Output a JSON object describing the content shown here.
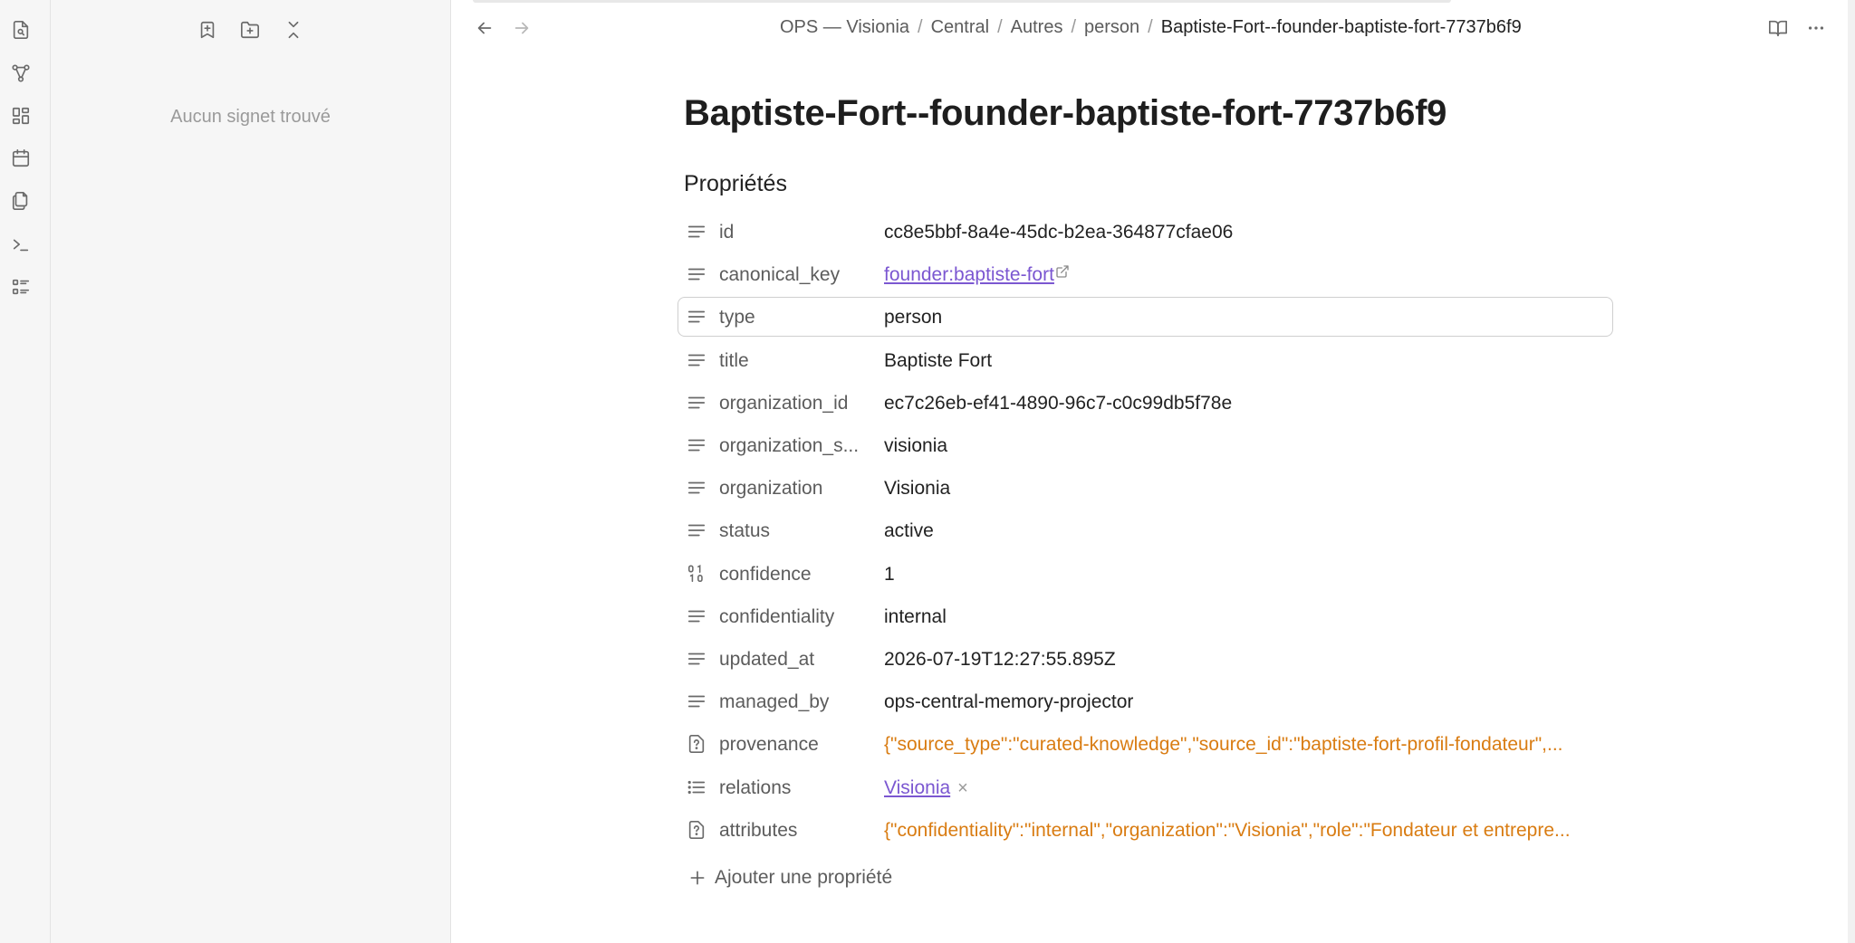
{
  "colors": {
    "accent": "#7b57d1",
    "json_value": "#d97c12",
    "muted": "#5c5c5c",
    "sidebar_bg": "#f6f6f6"
  },
  "ribbon": {
    "icons": [
      "search-file-icon",
      "graph-icon",
      "canvas-icon",
      "calendar-icon",
      "copy-icon",
      "terminal-icon",
      "list-icon"
    ]
  },
  "sidebar": {
    "buttons": [
      "add-bookmark-icon",
      "new-folder-icon",
      "collapse-all-icon"
    ],
    "empty_text": "Aucun signet trouvé"
  },
  "breadcrumb": [
    "OPS — Visionia",
    "Central",
    "Autres",
    "person",
    "Baptiste-Fort--founder-baptiste-fort-7737b6f9"
  ],
  "note": {
    "title": "Baptiste-Fort--founder-baptiste-fort-7737b6f9",
    "properties_heading": "Propriétés",
    "properties": [
      {
        "key": "id",
        "value": "cc8e5bbf-8a4e-45dc-b2ea-364877cfae06",
        "icon": "text-icon",
        "kind": "text"
      },
      {
        "key": "canonical_key",
        "value": "founder:baptiste-fort",
        "icon": "text-icon",
        "kind": "link"
      },
      {
        "key": "type",
        "value": "person",
        "icon": "text-icon",
        "kind": "text"
      },
      {
        "key": "title",
        "value": "Baptiste Fort",
        "icon": "text-icon",
        "kind": "text"
      },
      {
        "key": "organization_id",
        "value": "ec7c26eb-ef41-4890-96c7-c0c99db5f78e",
        "icon": "text-icon",
        "kind": "text"
      },
      {
        "key": "organization_s...",
        "value": "visionia",
        "icon": "text-icon",
        "kind": "text"
      },
      {
        "key": "organization",
        "value": "Visionia",
        "icon": "text-icon",
        "kind": "text"
      },
      {
        "key": "status",
        "value": "active",
        "icon": "text-icon",
        "kind": "text"
      },
      {
        "key": "confidence",
        "value": "1",
        "icon": "number-icon",
        "kind": "text"
      },
      {
        "key": "confidentiality",
        "value": "internal",
        "icon": "text-icon",
        "kind": "text"
      },
      {
        "key": "updated_at",
        "value": "2026-07-19T12:27:55.895Z",
        "icon": "text-icon",
        "kind": "text"
      },
      {
        "key": "managed_by",
        "value": "ops-central-memory-projector",
        "icon": "text-icon",
        "kind": "text"
      },
      {
        "key": "provenance",
        "value": "{\"source_type\":\"curated-knowledge\",\"source_id\":\"baptiste-fort-profil-fondateur\",...",
        "icon": "unknown-type-icon",
        "kind": "json"
      },
      {
        "key": "relations",
        "value": "Visionia",
        "icon": "list-icon",
        "kind": "list-link"
      },
      {
        "key": "attributes",
        "value": "{\"confidentiality\":\"internal\",\"organization\":\"Visionia\",\"role\":\"Fondateur et entrepre...",
        "icon": "unknown-type-icon",
        "kind": "json"
      }
    ],
    "highlighted_index": 2,
    "add_property_label": "Ajouter une propriété"
  }
}
